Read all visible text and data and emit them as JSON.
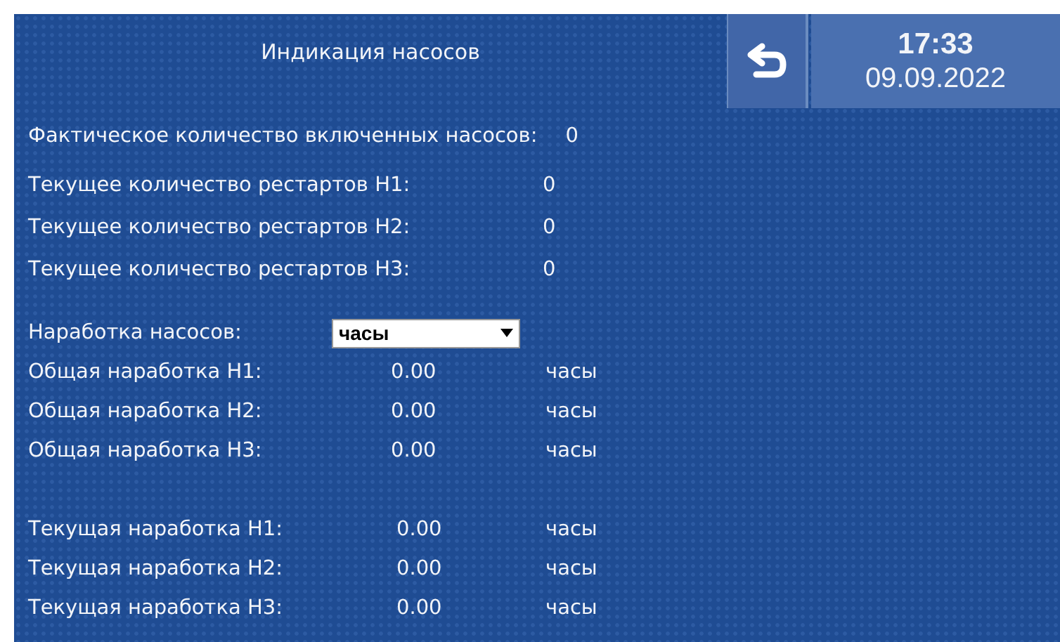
{
  "header": {
    "title": "Индикация насосов",
    "time": "17:33",
    "date": "09.09.2022"
  },
  "active_pumps": {
    "label": "Фактическое количество включенных насосов:",
    "value": "0"
  },
  "restarts": [
    {
      "label": "Текущее количество рестартов Н1:",
      "value": "0"
    },
    {
      "label": "Текущее количество рестартов Н2:",
      "value": "0"
    },
    {
      "label": "Текущее количество рестартов Н3:",
      "value": "0"
    }
  ],
  "runtime_unit": {
    "label": "Наработка насосов:",
    "value": "часы"
  },
  "total_runtime": [
    {
      "label": "Общая наработка Н1:",
      "value": "0.00",
      "unit": "часы"
    },
    {
      "label": "Общая наработка Н2:",
      "value": "0.00",
      "unit": "часы"
    },
    {
      "label": "Общая наработка Н3:",
      "value": "0.00",
      "unit": "часы"
    }
  ],
  "current_runtime": [
    {
      "label": "Текущая наработка Н1:",
      "value": "0.00",
      "unit": "часы"
    },
    {
      "label": "Текущая наработка Н2:",
      "value": "0.00",
      "unit": "часы"
    },
    {
      "label": "Текущая наработка Н3:",
      "value": "0.00",
      "unit": "часы"
    }
  ]
}
